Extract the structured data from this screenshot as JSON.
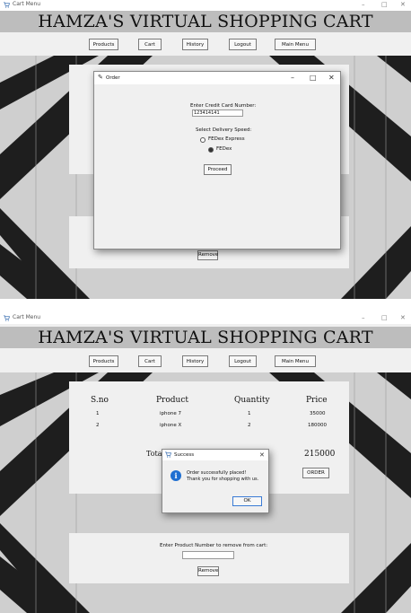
{
  "top": {
    "window_title": "Cart Menu",
    "banner": "HAMZA'S VIRTUAL SHOPPING CART",
    "nav": [
      "Products",
      "Cart",
      "History",
      "Logout",
      "Main Menu"
    ],
    "order_dialog": {
      "title": "Order",
      "card_label": "Enter Credit Card Number:",
      "card_value": "123414141",
      "speed_label": "Select Delivery Speed:",
      "options": [
        "FEDex Express",
        "FEDex"
      ],
      "selected_option": "FEDex",
      "proceed": "Proceed"
    },
    "remove_button": "Remove"
  },
  "bottom": {
    "window_title": "Cart Menu",
    "banner": "HAMZA'S VIRTUAL SHOPPING CART",
    "nav": [
      "Products",
      "Cart",
      "History",
      "Logout",
      "Main Menu"
    ],
    "table": {
      "headers": [
        "S.no",
        "Product",
        "Quantity",
        "Price"
      ],
      "rows": [
        [
          "1",
          "iphone 7",
          "1",
          "35000"
        ],
        [
          "2",
          "iphone X",
          "2",
          "180000"
        ]
      ]
    },
    "total_label": "Tota",
    "total_value": "215000",
    "order_button": "ORDER",
    "success_dialog": {
      "title": "Success",
      "message_line1": "Order successfully placed!",
      "message_line2": "Thank you for shopping with us.",
      "ok": "OK",
      "icon_glyph": "i"
    },
    "remove_label": "Enter Product Number to remove from cart:",
    "remove_input_value": "",
    "remove_button": "Remove"
  },
  "window_controls": {
    "minimize": "–",
    "maximize": "□",
    "close": "✕"
  }
}
